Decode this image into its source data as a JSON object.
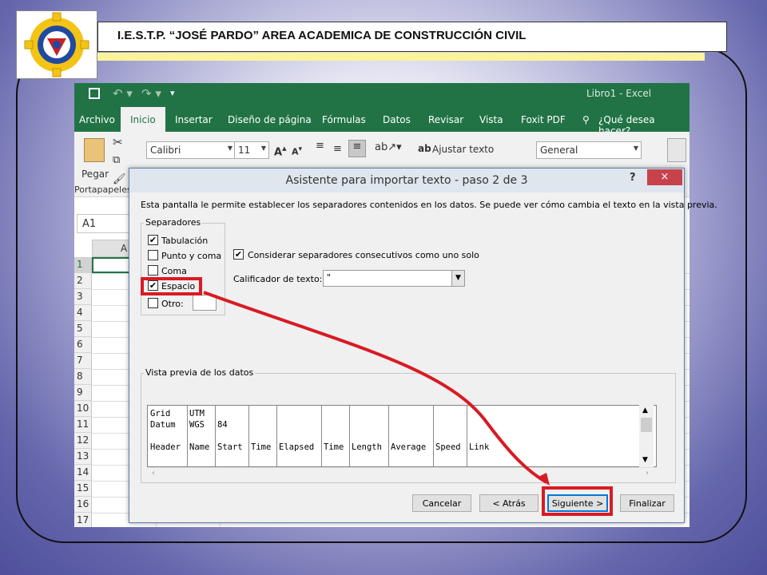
{
  "slide": {
    "title": "I.E.S.T.P. “JOSÉ PARDO” AREA ACADEMICA DE CONSTRUCCIÓN CIVIL",
    "colors": {
      "background": "#6566ac",
      "highlight": "#d81b24",
      "accent_bar": "#fbf39a"
    }
  },
  "excel": {
    "window_title": "Libro1 - Excel",
    "tabs": [
      "Archivo",
      "Inicio",
      "Insertar",
      "Diseño de página",
      "Fórmulas",
      "Datos",
      "Revisar",
      "Vista",
      "Foxit PDF"
    ],
    "active_tab": "Inicio",
    "tell_me": "¿Qué desea hacer?",
    "ribbon": {
      "paste_label": "Pegar",
      "clipboard_group": "Portapapeles",
      "font_name": "Calibri",
      "font_size": "11",
      "wrap_text": "Ajustar texto",
      "number_format": "General"
    },
    "name_box": "A1",
    "column_header": "A",
    "row_numbers": [
      "1",
      "2",
      "3",
      "4",
      "5",
      "6",
      "7",
      "8",
      "9",
      "10",
      "11",
      "12",
      "13",
      "14",
      "15",
      "16",
      "17"
    ],
    "accent_color": "#217346"
  },
  "dialog": {
    "title": "Asistente para importar texto - paso 2 de 3",
    "help": "?",
    "close": "×",
    "description": "Esta pantalla le permite establecer los separadores contenidos en los datos. Se puede ver cómo cambia el texto en la vista previa.",
    "separators_label": "Separadores",
    "separators": [
      {
        "label": "Tabulación",
        "checked": true
      },
      {
        "label": "Punto y coma",
        "checked": false
      },
      {
        "label": "Coma",
        "checked": false
      },
      {
        "label": "Espacio",
        "checked": true
      },
      {
        "label": "Otro:",
        "checked": false
      }
    ],
    "consecutive_label": "Considerar separadores consecutivos como uno solo",
    "consecutive_checked": true,
    "qualifier_label": "Calificador de texto:",
    "qualifier_value": "\"",
    "preview_label": "Vista previa de los datos",
    "preview_rows": [
      [
        "Grid",
        "UTM"
      ],
      [
        "Datum",
        "WGS",
        "84"
      ],
      [],
      [
        "Header",
        "Name",
        "Start",
        "Time",
        "Elapsed",
        "Time",
        "Length",
        "Average",
        "Speed",
        "Link"
      ]
    ],
    "buttons": {
      "cancel": "Cancelar",
      "back": "< Atrás",
      "next": "Siguiente >",
      "finish": "Finalizar"
    }
  }
}
